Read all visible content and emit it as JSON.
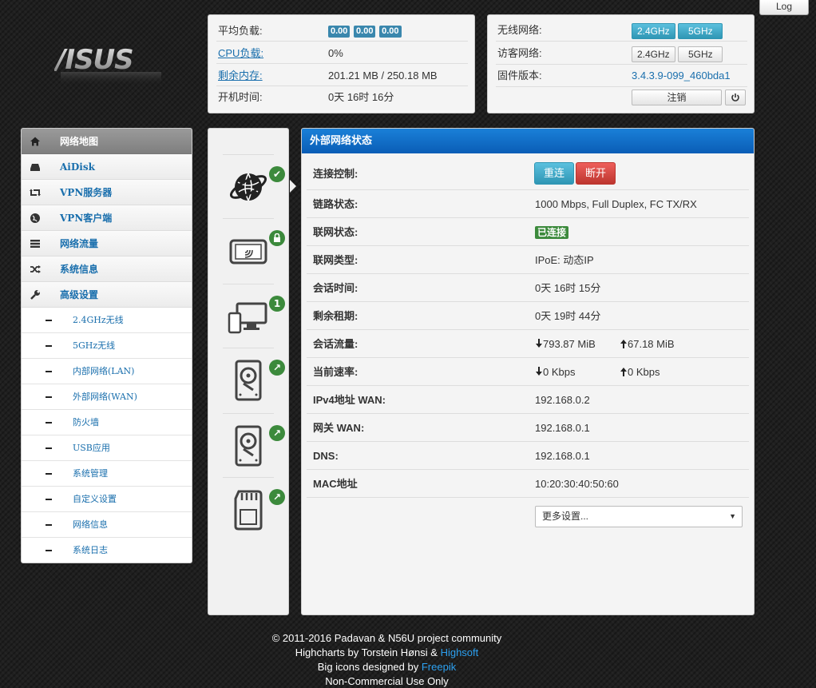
{
  "header": {
    "log_label": "Log",
    "logo_text": "/ISUS"
  },
  "status": {
    "load_label": "平均负载:",
    "load_values": [
      "0.00",
      "0.00",
      "0.00"
    ],
    "cpu_label": "CPU负载:",
    "cpu_value": "0%",
    "mem_label": "剩余内存:",
    "mem_value": "201.21 MB / 250.18 MB",
    "uptime_label": "开机时间:",
    "uptime_value": "0天 16时 16分"
  },
  "wifi": {
    "wireless_label": "无线网络:",
    "guest_label": "访客网络:",
    "band_24": "2.4GHz",
    "band_5": "5GHz",
    "firmware_label": "固件版本:",
    "firmware_value": "3.4.3.9-099_460bda1",
    "logout_label": "注销",
    "power_icon": "power-icon"
  },
  "sidebar": {
    "items": [
      {
        "label": "网络地图",
        "icon": "home-icon"
      },
      {
        "label": "AiDisk",
        "icon": "drive-icon"
      },
      {
        "label": "VPN服务器",
        "icon": "retweet-icon"
      },
      {
        "label": "VPN客户端",
        "icon": "globe-icon"
      },
      {
        "label": "网络流量",
        "icon": "list-icon"
      },
      {
        "label": "系统信息",
        "icon": "random-icon"
      },
      {
        "label": "高级设置",
        "icon": "wrench-icon"
      }
    ],
    "subitems": [
      "2.4GHz无线",
      "5GHz无线",
      "内部网络(LAN)",
      "外部网络(WAN)",
      "防火墙",
      "USB应用",
      "系统管理",
      "自定义设置",
      "网络信息",
      "系统日志"
    ]
  },
  "devices": {
    "badges": [
      "✔",
      "🔒",
      "1",
      "↗",
      "↗",
      "↗"
    ]
  },
  "wan": {
    "title": "外部网络状态",
    "rows": [
      {
        "k": "连接控制:"
      },
      {
        "k": "链路状态:",
        "v": "1000 Mbps, Full Duplex, FC TX/RX"
      },
      {
        "k": "联网状态:",
        "v": "已连接"
      },
      {
        "k": "联网类型:",
        "v": "IPoE: 动态IP"
      },
      {
        "k": "会话时间:",
        "v": "0天 16时 15分"
      },
      {
        "k": "剩余租期:",
        "v": "0天 19时 44分"
      },
      {
        "k": "会话流量:",
        "down": "793.87 MiB",
        "up": "67.18 MiB"
      },
      {
        "k": "当前速率:",
        "down": "0 Kbps",
        "up": "0 Kbps"
      },
      {
        "k": "IPv4地址 WAN:",
        "v": "192.168.0.2"
      },
      {
        "k": "网关 WAN:",
        "v": "192.168.0.1"
      },
      {
        "k": "DNS:",
        "v": "192.168.0.1"
      },
      {
        "k": "MAC地址",
        "v": "10:20:30:40:50:60"
      }
    ],
    "reconnect_label": "重连",
    "disconnect_label": "断开",
    "more_placeholder": "更多设置..."
  },
  "footer": {
    "line1": "© 2011-2016 Padavan & N56U project community",
    "line2_prefix": "Highcharts by Torstein Hønsi & ",
    "line2_link": "Highsoft",
    "line3_prefix": "Big icons designed by ",
    "line3_link": "Freepik",
    "line4": "Non-Commercial Use Only"
  }
}
